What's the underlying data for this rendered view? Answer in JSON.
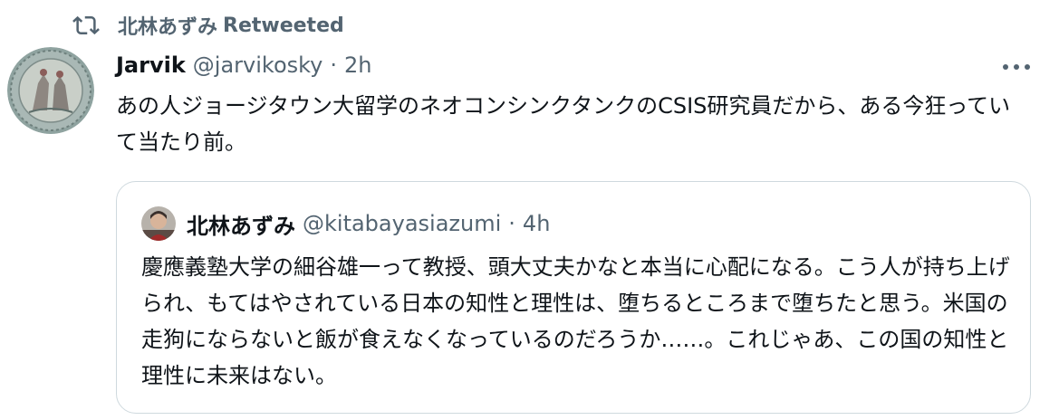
{
  "retweet": {
    "icon": "retweet-icon",
    "name": "北林あずみ",
    "label": "Retweeted"
  },
  "tweet": {
    "display_name": "Jarvik",
    "handle": "@jarvikosky",
    "separator": "·",
    "time": "2h",
    "text": "あの人ジョージタウン大留学のネオコンシンクタンクのCSIS研究員だから、ある今狂っていて当たり前。",
    "more_icon": "more-icon"
  },
  "quote": {
    "display_name": "北林あずみ",
    "handle": "@kitabayasiazumi",
    "separator": "·",
    "time": "4h",
    "text": "慶應義塾大学の細谷雄一って教授、頭大丈夫かなと本当に心配になる。こう人が持ち上げられ、もてはやされている日本の知性と理性は、堕ちるところまで堕ちたと思う。米国の走狗にならないと飯が食えなくなっているのだろうか……。これじゃあ、この国の知性と理性に未来はない。"
  },
  "colors": {
    "text_primary": "#0f1419",
    "text_secondary": "#536471",
    "border": "#cfd9de"
  }
}
